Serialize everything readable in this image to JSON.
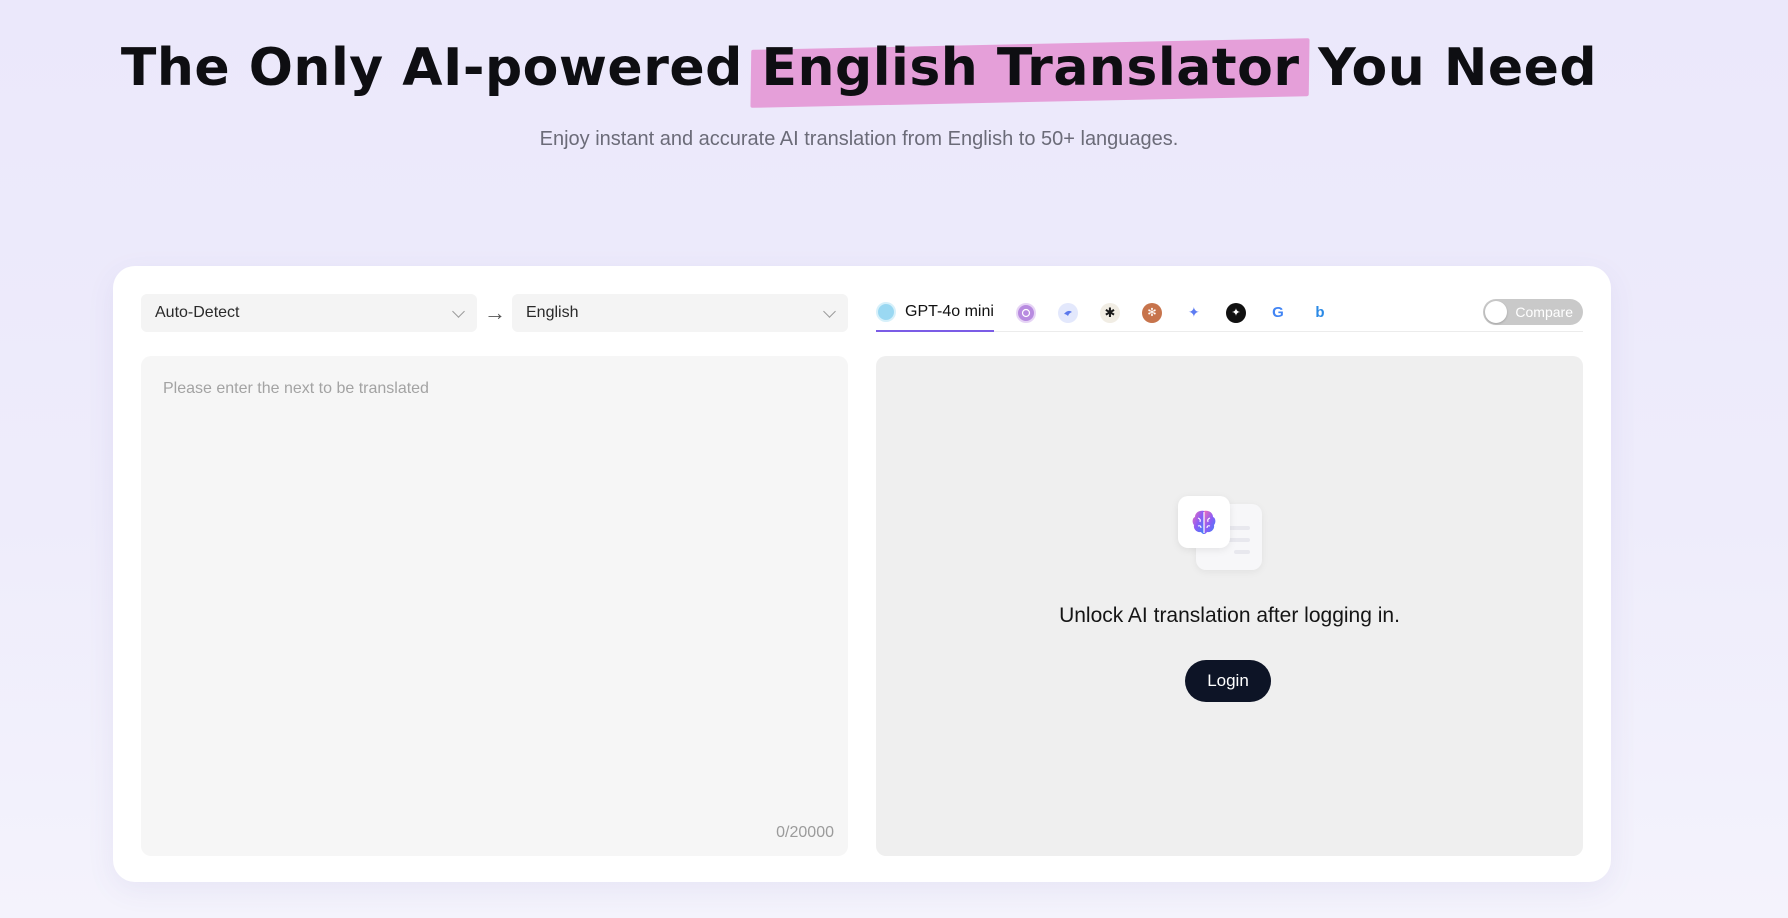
{
  "hero": {
    "title_before": "The Only AI-powered ",
    "title_highlight": "English Translator",
    "title_after": " You Need",
    "subtitle": "Enjoy instant and accurate AI translation from English to 50+ languages."
  },
  "translator": {
    "source_language": "Auto-Detect",
    "target_language": "English",
    "input_value": "",
    "input_placeholder": "Please enter the next to be translated",
    "char_count": "0/20000"
  },
  "models": {
    "active_label": "GPT-4o mini",
    "icons": [
      {
        "name": "gpt-4o-mini-icon",
        "color": "#9ad8f2"
      },
      {
        "name": "purple-model-icon",
        "color": "#b88be0"
      },
      {
        "name": "blue-bird-model-icon",
        "color": "#6f8ef0"
      },
      {
        "name": "asterisk-model-icon",
        "color": "#1a1a1a"
      },
      {
        "name": "orange-model-icon",
        "color": "#c7744c"
      },
      {
        "name": "sparkle-model-icon",
        "color": "#5d7cf2"
      },
      {
        "name": "dark-sparkle-model-icon",
        "color": "#111111"
      },
      {
        "name": "google-icon",
        "color": "#4285f4"
      },
      {
        "name": "bing-icon",
        "color": "#2b8ae6"
      }
    ],
    "compare_label": "Compare"
  },
  "result": {
    "message": "Unlock AI translation after logging in.",
    "login_label": "Login"
  },
  "colors": {
    "accent": "#7b5ce6",
    "highlight": "#e59fd9",
    "login_bg": "#0d1426"
  }
}
